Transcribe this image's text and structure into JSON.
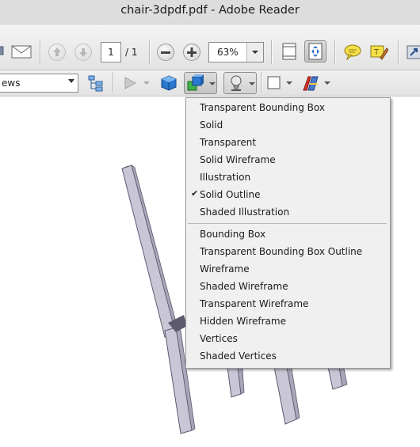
{
  "window": {
    "title": "chair-3dpdf.pdf - Adobe Reader"
  },
  "toolbar": {
    "page_current": "1",
    "page_total": "/ 1",
    "zoom": "63%"
  },
  "toolbar3d": {
    "views_label": "ews"
  },
  "menu": {
    "group1": [
      {
        "label": "Transparent Bounding Box",
        "checked": false
      },
      {
        "label": "Solid",
        "checked": false
      },
      {
        "label": "Transparent",
        "checked": false
      },
      {
        "label": "Solid Wireframe",
        "checked": false
      },
      {
        "label": "Illustration",
        "checked": false
      },
      {
        "label": "Solid Outline",
        "checked": true
      },
      {
        "label": "Shaded Illustration",
        "checked": false
      }
    ],
    "group2": [
      {
        "label": "Bounding Box"
      },
      {
        "label": "Transparent Bounding Box Outline"
      },
      {
        "label": "Wireframe"
      },
      {
        "label": "Shaded Wireframe"
      },
      {
        "label": "Transparent Wireframe"
      },
      {
        "label": "Hidden Wireframe"
      },
      {
        "label": "Vertices"
      },
      {
        "label": "Shaded Vertices"
      }
    ],
    "check_glyph": "✔"
  },
  "icons": {
    "mail": "envelope-icon",
    "prev_page": "arrow-up-icon",
    "next_page": "arrow-down-icon",
    "zoom_out": "minus-icon",
    "zoom_in": "plus-icon",
    "fit_page": "fit-page-icon",
    "fit_width": "fit-width-icon",
    "comment": "speech-bubble-icon",
    "sign": "pen-icon",
    "expand": "expand-icon"
  },
  "colors": {
    "chair_light": "#c9c7d6",
    "chair_mid": "#a9a6ba",
    "chair_dark": "#5d5a6e",
    "menu_bg": "#f0f0f0"
  }
}
